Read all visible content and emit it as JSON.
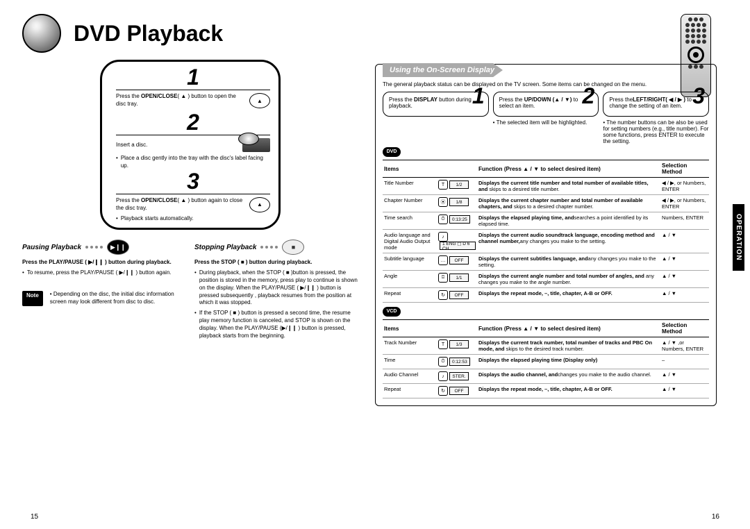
{
  "page_title": "DVD Playback",
  "side_tab": "OPERATION",
  "page_num_left": "15",
  "page_num_right": "16",
  "left": {
    "step1": {
      "num": "1",
      "instr_pre": "Press the ",
      "instr_bold": "OPEN/CLOSE",
      "instr_post": "( ▲ ) button to open the disc tray."
    },
    "step2": {
      "num": "2",
      "instr": "Insert a disc.",
      "bullet": "Place a disc gently into the tray with the disc's label facing up."
    },
    "step3": {
      "num": "3",
      "instr_pre": "Press the ",
      "instr_bold": "OPEN/CLOSE",
      "instr_post": "( ▲ ) button again to close the disc tray.",
      "bullet": "Playback starts automatically."
    },
    "pausing": {
      "title": "Pausing Playback",
      "main": "Press the PLAY/PAUSE ( ▶/❙❙ ) button during playback.",
      "bullet1": "To resume, press the PLAY/PAUSE ( ▶/❙❙ ) button again.",
      "note_label": "Note",
      "note_text": "Depending on the disc, the initial disc information screen may look different from disc to disc."
    },
    "stopping": {
      "title": "Stopping Playback",
      "main": "Press the STOP ( ■ ) button during playback.",
      "bullet1": "During playback, when the STOP ( ■ )button is pressed, the position is stored in the memory, press play to continue is shown on the display. When the PLAY/PAUSE ( ▶/❙❙ ) button is pressed subsequently , playback resumes from the position at which it was stopped.",
      "bullet2": "If the STOP ( ■ ) button is pressed a second time, the resume play memory function is canceled, and STOP is shown on the display. When the PLAY/PAUSE (▶/❙❙ ) button is pressed, playback starts from the beginning."
    }
  },
  "right": {
    "tab_title": "Using the On-Screen Display",
    "intro": "The general playback status can be displayed on the TV screen. Some items can be changed on the menu.",
    "steps": [
      {
        "num": "1",
        "text_pre": "Press the ",
        "text_bold": "DISPLAY",
        "text_post": " button during playback."
      },
      {
        "num": "2",
        "text_pre": "Press the ",
        "text_bold": "UP/DOWN (▲ / ▼)",
        "text_post": " to select an item.",
        "note": "The selected item will be highlighted."
      },
      {
        "num": "3",
        "text_pre": "Press the",
        "text_bold": "LEFT/RIGHT( ◀ / ▶ )",
        "text_post": " to change the setting of an item.",
        "note": "The number buttons can be also be used for setting numbers (e.g., title number). For some functions, press ENTER to execute the setting."
      }
    ],
    "badge1": "DVD",
    "badge2": "VCD",
    "table1_headers": {
      "items": "Items",
      "function": "Function (Press ▲ / ▼ to select desired item)",
      "selection": "Selection Method"
    },
    "table1_rows": [
      {
        "item": "Title Number",
        "icon": "T",
        "value": "1/2",
        "func_b": "Displays the current title number and total number of available titles, and ",
        "func_n": "skips to a desired title number.",
        "sel": "◀ / ▶, or Numbers, ENTER"
      },
      {
        "item": "Chapter Number",
        "icon": "⦿",
        "value": "1/8",
        "func_b": "Displays the current chapter number and total number of available chapters, and ",
        "func_n": "skips to a desired chapter number.",
        "sel": "◀ / ▶, or Numbers, ENTER"
      },
      {
        "item": "Time search",
        "icon": "⏱",
        "value": "0:13:25",
        "func_b": "Displays the elapsed playing time, and",
        "func_n": "searches a point identified by its elapsed time.",
        "sel": "Numbers, ENTER"
      },
      {
        "item": "Audio language and Digital Audio Output mode",
        "icon": "♪",
        "value": "1 ENG ▢ D 6 CH",
        "func_b": "Displays the current audio soundtrack language, encoding method and channel number,",
        "func_n": "any changes you make to the setting.",
        "sel": "▲ / ▼"
      },
      {
        "item": "Subtitle language",
        "icon": "…",
        "value": "OFF",
        "func_b": "Displays the current subtitles language, and",
        "func_n": "any changes you make to the setting.",
        "sel": "▲ / ▼"
      },
      {
        "item": "Angle",
        "icon": "⌼",
        "value": "1/1",
        "func_b": "Displays the current angle number and total number of angles, and ",
        "func_n": "any changes you make to the angle number.",
        "sel": "▲ / ▼"
      },
      {
        "item": "Repeat",
        "icon": "↻",
        "value": "OFF",
        "func_b": "Displays the repeat mode, –, title, chapter, A-B or OFF.",
        "func_n": "",
        "sel": "▲ / ▼"
      }
    ],
    "table2_rows": [
      {
        "item": "Track Number",
        "icon": "T",
        "value": "1/3",
        "func_b": "Displays the current track number, total number of tracks and PBC On mode, and ",
        "func_n": "skips to the desired track number.",
        "sel": "▲ / ▼ ,or Numbers, ENTER"
      },
      {
        "item": "Time",
        "icon": "⏱",
        "value": "0:12:53",
        "func_b": "Displays the elapsed playing time (Display only)",
        "func_n": "",
        "sel": "–"
      },
      {
        "item": "Audio Channel",
        "icon": "♪",
        "value": "STER.",
        "func_b": "Displays the audio channel, and",
        "func_n": "changes you make to the audio channel.",
        "sel": "▲ / ▼"
      },
      {
        "item": "Repeat",
        "icon": "↻",
        "value": "OFF",
        "func_b": "Displays the repeat mode, –, title, chapter, A-B or OFF.",
        "func_n": "",
        "sel": "▲ / ▼"
      }
    ]
  }
}
